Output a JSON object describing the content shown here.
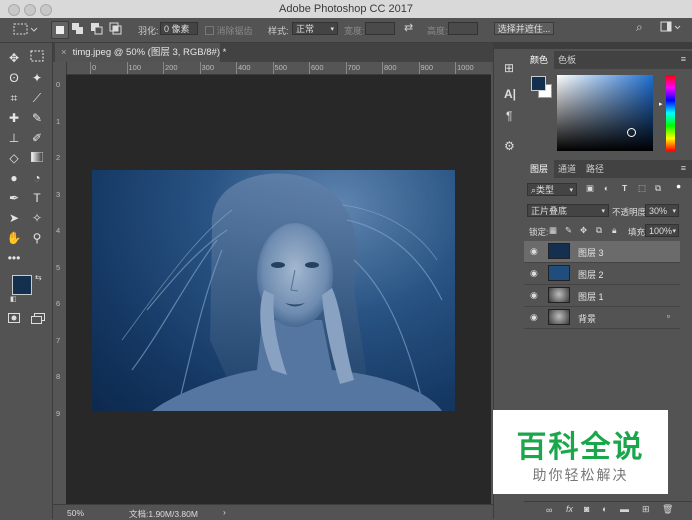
{
  "window": {
    "title": "Adobe Photoshop CC 2017"
  },
  "options_bar": {
    "feather_label": "羽化:",
    "feather_value": "0 像素",
    "antialias_label": "消除锯齿",
    "style_label": "样式:",
    "style_value": "正常",
    "width_label": "宽度:",
    "height_label": "高度:",
    "select_mask_button": "选择并遮住..."
  },
  "document": {
    "tab_title": "timg.jpeg @ 50% (图层 3, RGB/8#) *",
    "zoom": "50%",
    "doc_info": "文档:1.90M/3.80M"
  },
  "ruler": {
    "h_ticks": [
      "0",
      "100",
      "200",
      "300",
      "400",
      "500",
      "600",
      "700",
      "800",
      "900",
      "1000"
    ],
    "v_ticks": [
      "0",
      "1",
      "2",
      "3",
      "4",
      "5",
      "6",
      "7",
      "8",
      "9"
    ]
  },
  "color_panel": {
    "tabs": [
      "颜色",
      "色板"
    ],
    "foreground": "#14304f",
    "background": "#ffffff",
    "field_hue": "#1f6fd1"
  },
  "layers_panel": {
    "tabs": [
      "图层",
      "通道",
      "路径"
    ],
    "filter_kind": "类型",
    "blend_mode": "正片叠底",
    "opacity_label": "不透明度:",
    "opacity_value": "30%",
    "lock_label": "锁定:",
    "fill_label": "填充:",
    "fill_value": "100%",
    "layers": [
      {
        "name": "图层 3",
        "selected": true,
        "thumb": "#15304f"
      },
      {
        "name": "图层 2",
        "selected": false,
        "thumb": "#1e4d7e"
      },
      {
        "name": "图层 1",
        "selected": false,
        "thumb": "photo"
      },
      {
        "name": "背景",
        "selected": false,
        "thumb": "photo",
        "locked": true
      }
    ]
  },
  "watermark": {
    "title": "百科全说",
    "subtitle": "助你轻松解决"
  }
}
